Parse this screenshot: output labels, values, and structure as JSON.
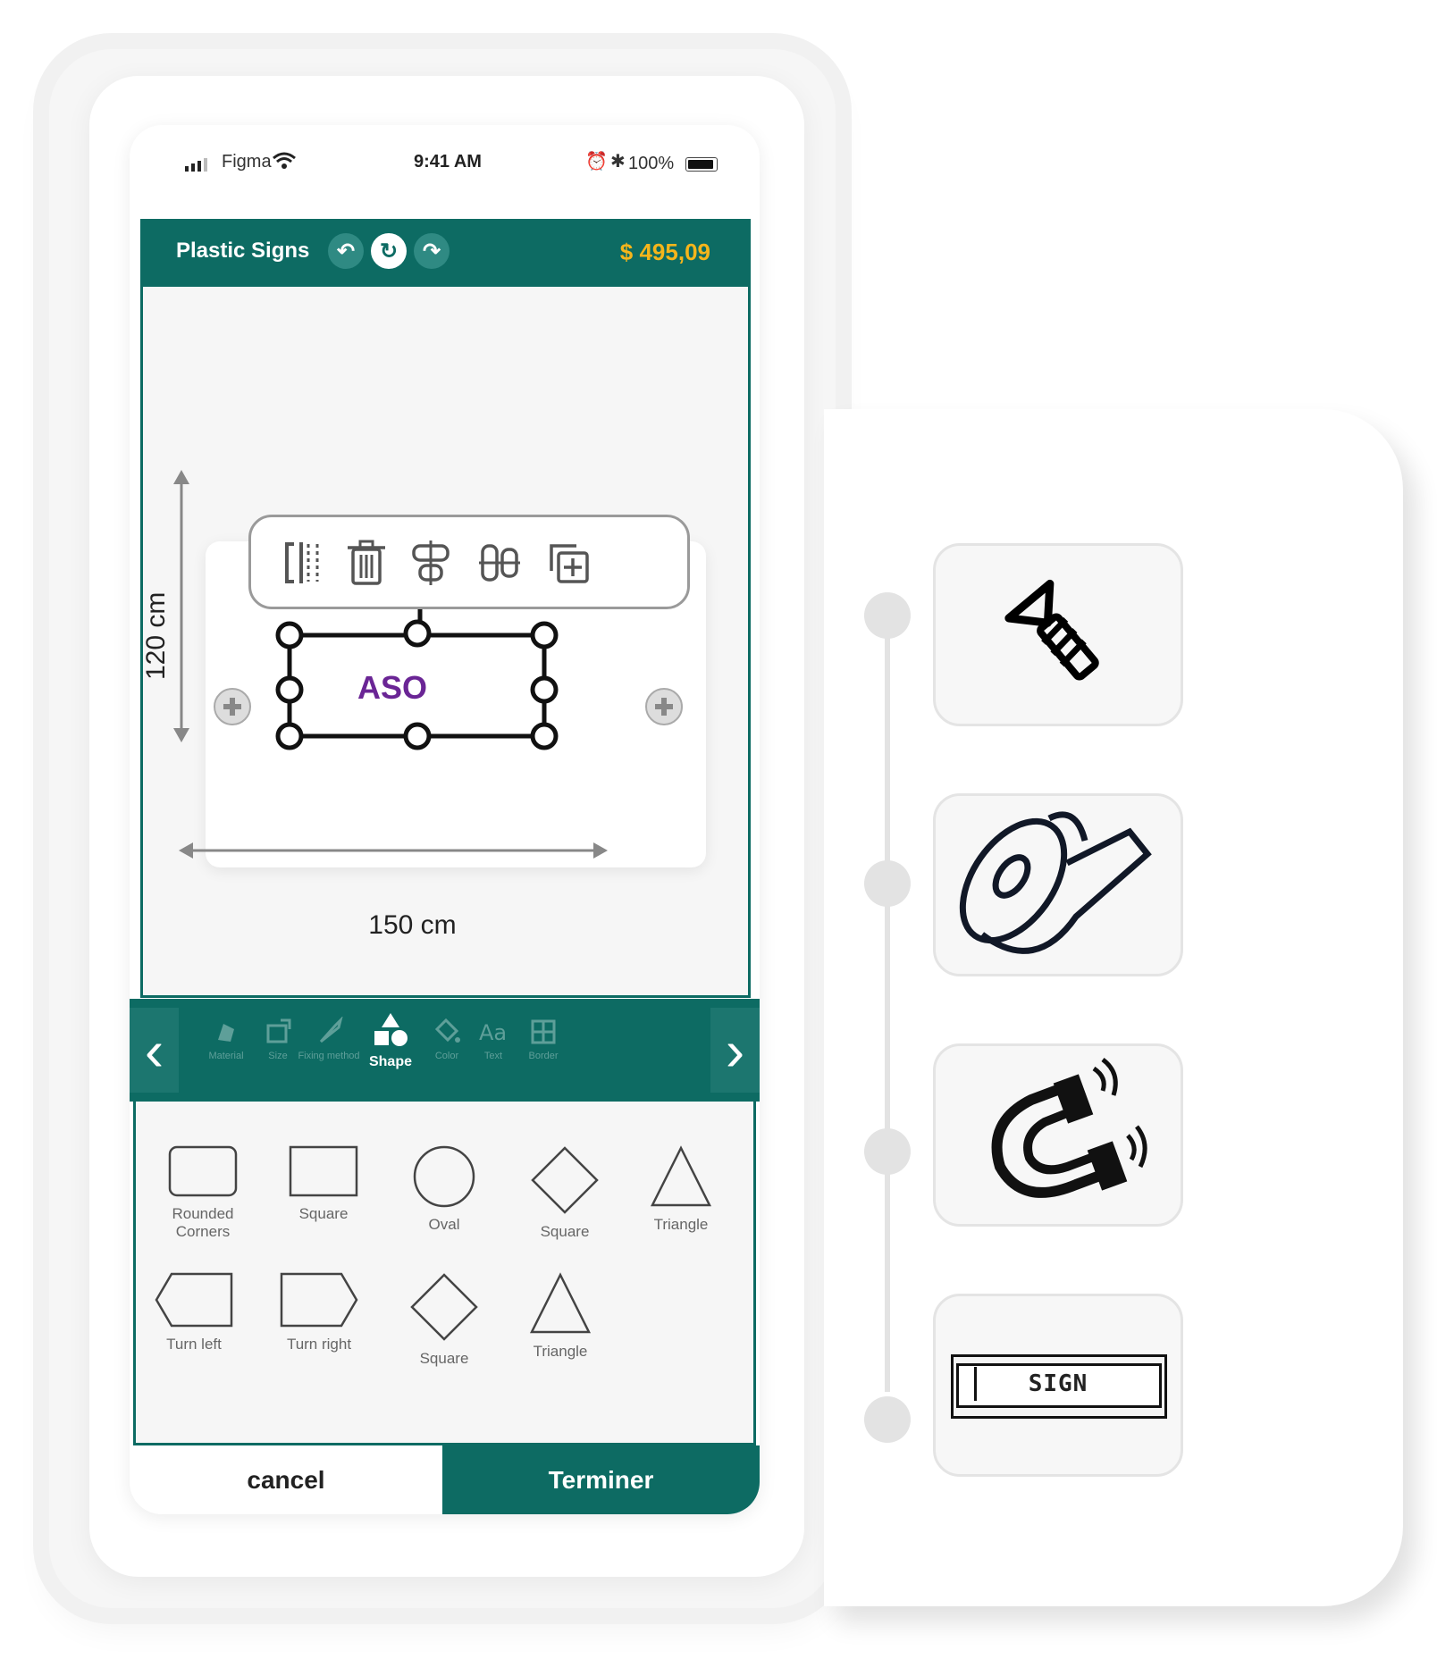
{
  "status_bar": {
    "carrier": "Figma",
    "time": "9:41 AM",
    "battery": "100%"
  },
  "header": {
    "title": "Plastic Signs",
    "price": "$ 495,09",
    "price_color": "#f5b51b",
    "brand_color": "#0d6b63"
  },
  "sign": {
    "text": "ASO",
    "text_color": "#6a2595"
  },
  "dimensions": {
    "height": "120 cm",
    "width": "150 cm"
  },
  "toolbar_icons": [
    "flip-icon",
    "trash-icon",
    "align-center-icon",
    "distribute-icon",
    "duplicate-icon"
  ],
  "nav": {
    "items": [
      {
        "label": "Material",
        "icon": "material-icon"
      },
      {
        "label": "Size",
        "icon": "size-icon"
      },
      {
        "label": "Fixing method",
        "icon": "screw-icon"
      },
      {
        "label": "Shape",
        "icon": "shape-icon",
        "active": true
      },
      {
        "label": "Color",
        "icon": "paint-bucket-icon"
      },
      {
        "label": "Text",
        "icon": "text-icon"
      },
      {
        "label": "Border",
        "icon": "border-icon"
      }
    ]
  },
  "shapes": {
    "row1": [
      "Rounded Corners",
      "Square",
      "Oval",
      "Square",
      "Triangle"
    ],
    "row2": [
      "Turn left",
      "Turn right",
      "Square",
      "Triangle"
    ]
  },
  "footer": {
    "cancel": "cancel",
    "finish": "Terminer"
  },
  "fixing_options": [
    {
      "icon": "screw-icon"
    },
    {
      "icon": "tape-icon"
    },
    {
      "icon": "magnet-icon"
    },
    {
      "icon": "sign-holder-icon",
      "label": "SIGN"
    }
  ]
}
